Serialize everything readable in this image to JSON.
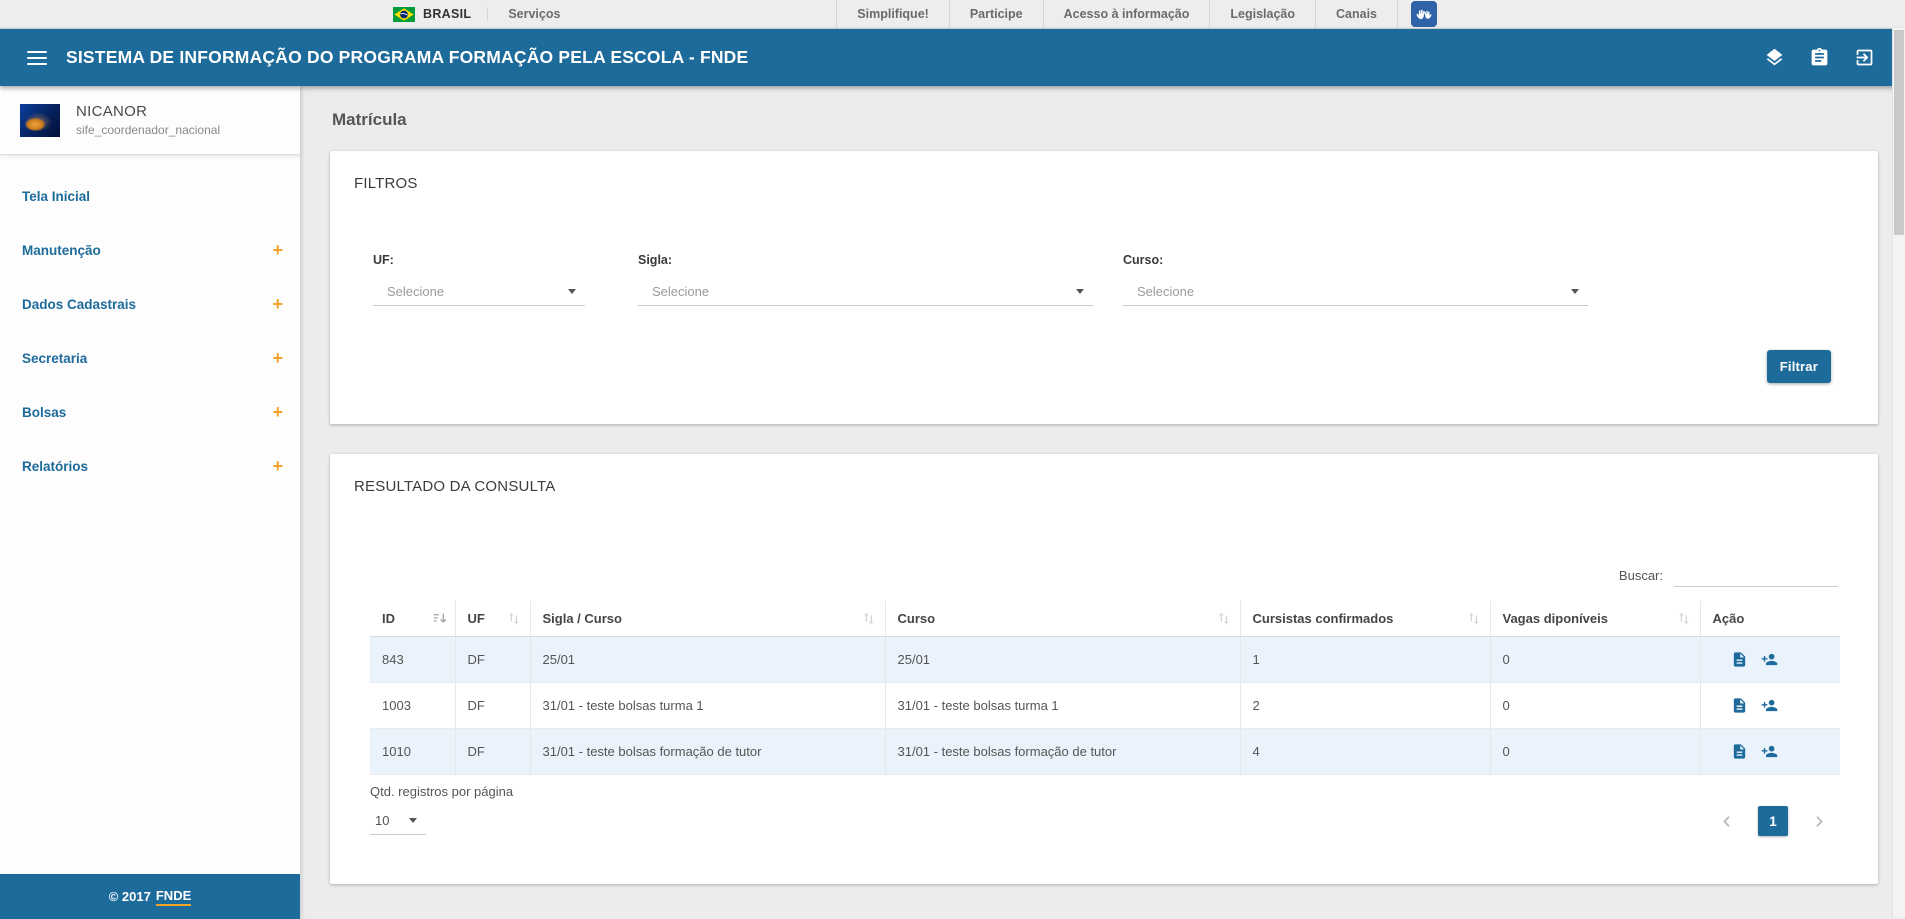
{
  "govbar": {
    "brand": "BRASIL",
    "servicos_label": "Serviços",
    "links": [
      "Simplifique!",
      "Participe",
      "Acesso à informação",
      "Legislação",
      "Canais"
    ]
  },
  "header": {
    "title": "SISTEMA DE INFORMAÇÃO DO PROGRAMA FORMAÇÃO PELA ESCOLA - FNDE",
    "icons": [
      "layers-icon",
      "clipboard-icon",
      "logout-icon"
    ]
  },
  "sidebar": {
    "user": {
      "name": "NICANOR",
      "role": "sife_coordenador_nacional"
    },
    "expand_glyph": "+",
    "items": [
      {
        "label": "Tela Inicial",
        "expandable": false
      },
      {
        "label": "Manutenção",
        "expandable": true
      },
      {
        "label": "Dados Cadastrais",
        "expandable": true
      },
      {
        "label": "Secretaria",
        "expandable": true
      },
      {
        "label": "Bolsas",
        "expandable": true
      },
      {
        "label": "Relatórios",
        "expandable": true
      }
    ],
    "footer": {
      "copyright": "© 2017",
      "brand": "FNDE"
    }
  },
  "main": {
    "page_title": "Matrícula",
    "filters": {
      "title": "FILTROS",
      "fields": [
        {
          "label": "UF:",
          "value": "Selecione"
        },
        {
          "label": "Sigla:",
          "value": "Selecione"
        },
        {
          "label": "Curso:",
          "value": "Selecione"
        }
      ],
      "submit_label": "Filtrar"
    },
    "results": {
      "title": "RESULTADO DA CONSULTA",
      "search_label": "Buscar:",
      "table": {
        "columns": [
          "ID",
          "UF",
          "Sigla / Curso",
          "Curso",
          "Cursistas confirmados",
          "Vagas diponíveis",
          "Ação"
        ],
        "action_icons": [
          "document-icon",
          "person-add-icon"
        ],
        "rows": [
          {
            "id": "843",
            "uf": "DF",
            "sigla": "25/01",
            "curso": "25/01",
            "cursistas": "1",
            "vagas": "0"
          },
          {
            "id": "1003",
            "uf": "DF",
            "sigla": "31/01 - teste bolsas turma 1",
            "curso": "31/01 - teste bolsas turma 1",
            "cursistas": "2",
            "vagas": "0"
          },
          {
            "id": "1010",
            "uf": "DF",
            "sigla": "31/01 - teste bolsas formação de tutor",
            "curso": "31/01 - teste bolsas formação de tutor",
            "cursistas": "4",
            "vagas": "0"
          }
        ]
      },
      "pagination": {
        "per_page_label": "Qtd. registros por página",
        "per_page_value": "10",
        "current_page": "1"
      }
    }
  },
  "colors": {
    "primary_blue": "#1d6b9b",
    "accent_orange": "#f5a429",
    "row_stripe": "#eaf2fb",
    "govbar_bg": "#ededed"
  }
}
